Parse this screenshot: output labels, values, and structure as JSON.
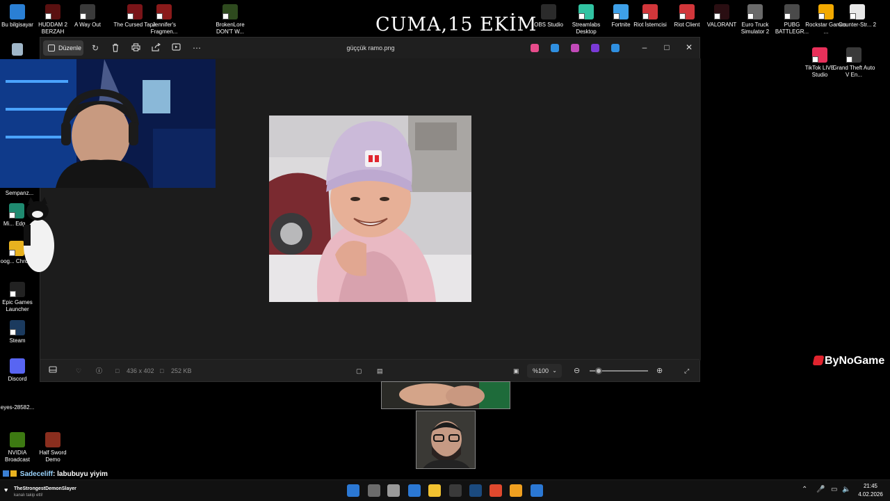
{
  "wallpaper": {
    "date_text": "CUMA,15 EKİM"
  },
  "desktop_icons_top": [
    {
      "label": "Bu bilgisayar",
      "color": "#2a7fd4"
    },
    {
      "label": "HUDDAM 2 BERZAH",
      "color": "#5a1010"
    },
    {
      "label": "A Way Out",
      "color": "#3a3a3a"
    },
    {
      "label": "The Cursed Tape",
      "color": "#7a1418"
    },
    {
      "label": "Jennifer's Fragmen...",
      "color": "#8a1a1a"
    },
    {
      "label": "BrokenLore DON'T W...",
      "color": "#2e4a1e"
    }
  ],
  "desktop_icons_top_right": [
    {
      "label": "OBS Studio",
      "color": "#2b2b2b"
    },
    {
      "label": "Streamlabs Desktop",
      "color": "#31c3a2"
    },
    {
      "label": "Fortnite",
      "color": "#3ea0e8"
    },
    {
      "label": "Riot İstemcisi",
      "color": "#d1363a"
    },
    {
      "label": "Riot Client",
      "color": "#d1363a"
    },
    {
      "label": "VALORANT",
      "color": "#2a0e12"
    },
    {
      "label": "Euro Truck Simulator 2",
      "color": "#6a6a6a"
    },
    {
      "label": "PUBG BATTLEGR...",
      "color": "#4a4a4a"
    },
    {
      "label": "Rockstar Games ...",
      "color": "#f2a900"
    },
    {
      "label": "Counter-Str... 2",
      "color": "#e8e8e8"
    }
  ],
  "desktop_icons_right_row2": [
    {
      "label": "TikTok LIVE Studio",
      "color": "#e8305a"
    },
    {
      "label": "Grand Theft Auto V En...",
      "color": "#3a3a3a"
    }
  ],
  "desktop_icons_left": [
    {
      "label": "Sempanz...",
      "color": "#111"
    },
    {
      "label": "Mi... Edg...",
      "color": "#1f8a70"
    },
    {
      "label": "Goog... Chrom...",
      "color": "#e8b21f"
    },
    {
      "label": "Epic Games Launcher",
      "color": "#222"
    },
    {
      "label": "Steam",
      "color": "#1b3a5e"
    },
    {
      "label": "Discord",
      "color": "#5865f2"
    },
    {
      "label": "eyes-28582...",
      "color": "#000"
    },
    {
      "label": "NVIDIA Broadcast",
      "color": "#3d7a12"
    },
    {
      "label": "Half Sword Demo",
      "color": "#8a2e1e"
    }
  ],
  "photos": {
    "edit_label": "Düzenle",
    "title": "güççük ramo.png",
    "dimensions": "436 x 402",
    "file_size": "252 KB",
    "zoom": "%100",
    "zoom_slider_fraction": 0.15,
    "app_icon_colors": [
      "#e74c8b",
      "#2f8fe0",
      "#c24ab8",
      "#7a3ad6",
      "#2f8fe0"
    ]
  },
  "brand": {
    "text": "ByNoGame"
  },
  "chat": {
    "user": "Sadeceliff",
    "message": ": labubuyu yiyim"
  },
  "follow_alert": {
    "name": "TheStrongestDemonSlayer",
    "sub": "kanalı takip etti!"
  },
  "taskbar": {
    "app_colors": [
      "#2b78d4",
      "#6c6c6c",
      "#9a9a9a",
      "#2b78d4",
      "#f2c230",
      "#3a3a3a",
      "#1b4a7e",
      "#e0492e",
      "#f0a020",
      "#2b78d4"
    ],
    "time": "21:45",
    "date": "4.02.2026"
  }
}
